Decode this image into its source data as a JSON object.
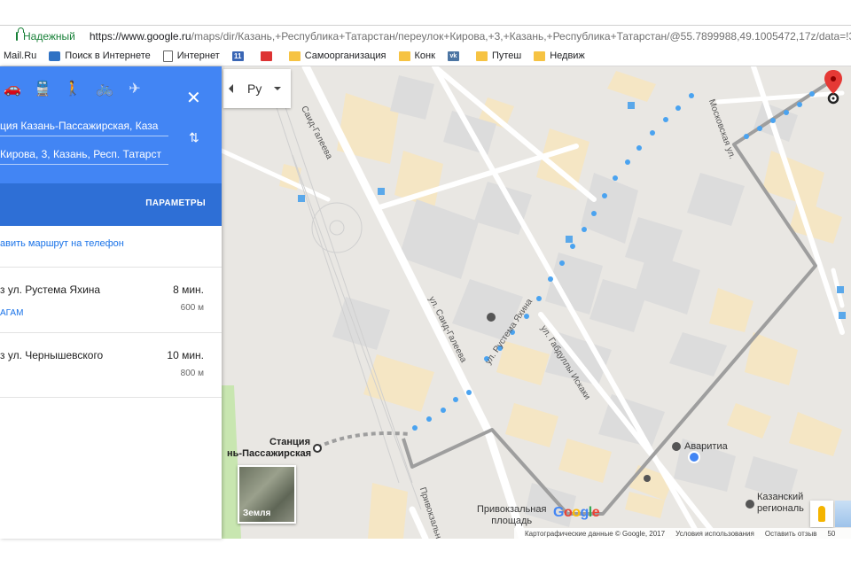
{
  "browser": {
    "secure_label": "Надежный",
    "url_host": "https://www.google.ru",
    "url_path": "/maps/dir/Казань,+Республика+Татарстан/переулок+Кирова,+3,+Казань,+Республика+Татарстан/@55.7899988,49.1005472,17z/data=!3m1"
  },
  "bookmarks": [
    {
      "label": "Mail.Ru",
      "icon": "none"
    },
    {
      "label": "Поиск в Интернете",
      "icon": "search-icon"
    },
    {
      "label": "Интернет",
      "icon": "page-icon"
    },
    {
      "label": "11",
      "icon": "badge-icon"
    },
    {
      "label": "",
      "icon": "red-icon"
    },
    {
      "label": "Самоорганизация",
      "icon": "folder-icon"
    },
    {
      "label": "Конк",
      "icon": "folder-icon"
    },
    {
      "label": "",
      "icon": "vk-icon"
    },
    {
      "label": "Путеш",
      "icon": "folder-icon"
    },
    {
      "label": "Недвиж",
      "icon": "folder-icon"
    }
  ],
  "panel": {
    "travel_modes": [
      "car-icon",
      "transit-icon",
      "walk-icon",
      "bicycle-icon",
      "flight-icon"
    ],
    "close_label": "✕",
    "origin": "ция Казань-Пассажирская, Каза",
    "destination": "Кирова, 3, Казань, Респ. Татарст",
    "options_label": "ПАРАМЕТРЫ",
    "send_to_phone": "авить маршрут на телефон",
    "routes": [
      {
        "via": "з ул. Рустема Яхина",
        "time": "8 мин.",
        "distance": "600 м",
        "mode": "АГАМ"
      },
      {
        "via": "з ул. Чернышевского",
        "time": "10 мин.",
        "distance": "800 м",
        "mode": ""
      }
    ]
  },
  "map": {
    "language": "Ру",
    "station_line1": "Станция",
    "station_line2": "нь-Пассажирская",
    "poi_avaritia": "Аваритиа",
    "poi_kazansky_1": "Казанский",
    "poi_kazansky_2": "региональ",
    "poi_square_1": "Привокзальная",
    "poi_square_2": "площадь",
    "streets": {
      "saida_galeeva_top": "Саид-Галеева",
      "saida_galeeva": "ул. Саид-Галеева",
      "rustema_yahina": "ул. Рустема Яхина",
      "gaaza_iskaki": "ул. Габдуллы Искаки",
      "moskovskaya": "Московская ул.",
      "privokzalnaya": "Привокзальн"
    },
    "earth_label": "Земля",
    "footer": {
      "copyright": "Картографические данные © Google, 2017",
      "terms": "Условия использования",
      "feedback": "Оставить отзыв",
      "scale": "50"
    }
  }
}
